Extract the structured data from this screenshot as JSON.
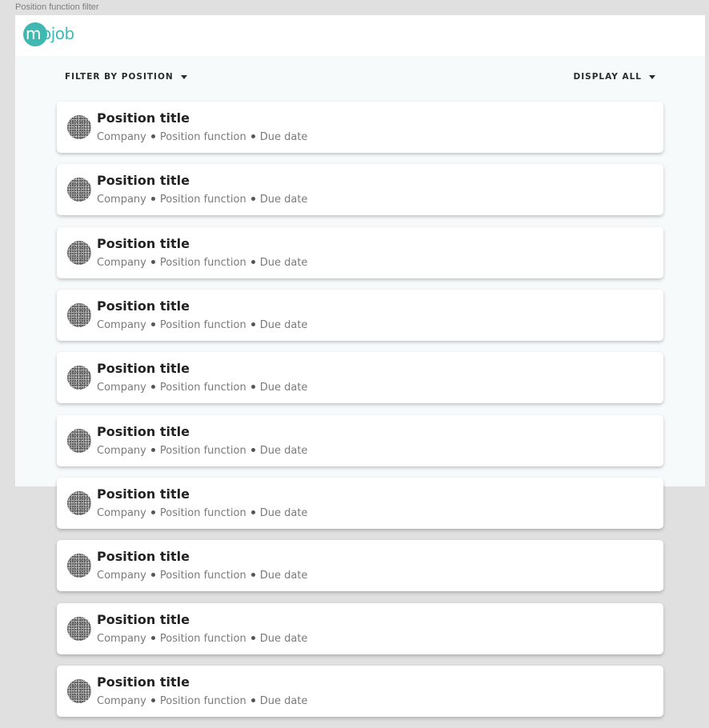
{
  "frame": {
    "label": "Position function filter"
  },
  "header": {
    "logo_m": "m",
    "logo_rest": "ojob",
    "brand_color": "#3fb8b1"
  },
  "filters": {
    "left_label": "FILTER BY POSITION",
    "right_label": "DISPLAY ALL"
  },
  "positions": [
    {
      "title": "Position title",
      "company": "Company",
      "function": "Position function",
      "due": "Due date"
    },
    {
      "title": "Position title",
      "company": "Company",
      "function": "Position function",
      "due": "Due date"
    },
    {
      "title": "Position title",
      "company": "Company",
      "function": "Position function",
      "due": "Due date"
    },
    {
      "title": "Position title",
      "company": "Company",
      "function": "Position function",
      "due": "Due date"
    },
    {
      "title": "Position title",
      "company": "Company",
      "function": "Position function",
      "due": "Due date"
    },
    {
      "title": "Position title",
      "company": "Company",
      "function": "Position function",
      "due": "Due date"
    },
    {
      "title": "Position title",
      "company": "Company",
      "function": "Position function",
      "due": "Due date"
    },
    {
      "title": "Position title",
      "company": "Company",
      "function": "Position function",
      "due": "Due date"
    },
    {
      "title": "Position title",
      "company": "Company",
      "function": "Position function",
      "due": "Due date"
    },
    {
      "title": "Position title",
      "company": "Company",
      "function": "Position function",
      "due": "Due date"
    }
  ]
}
